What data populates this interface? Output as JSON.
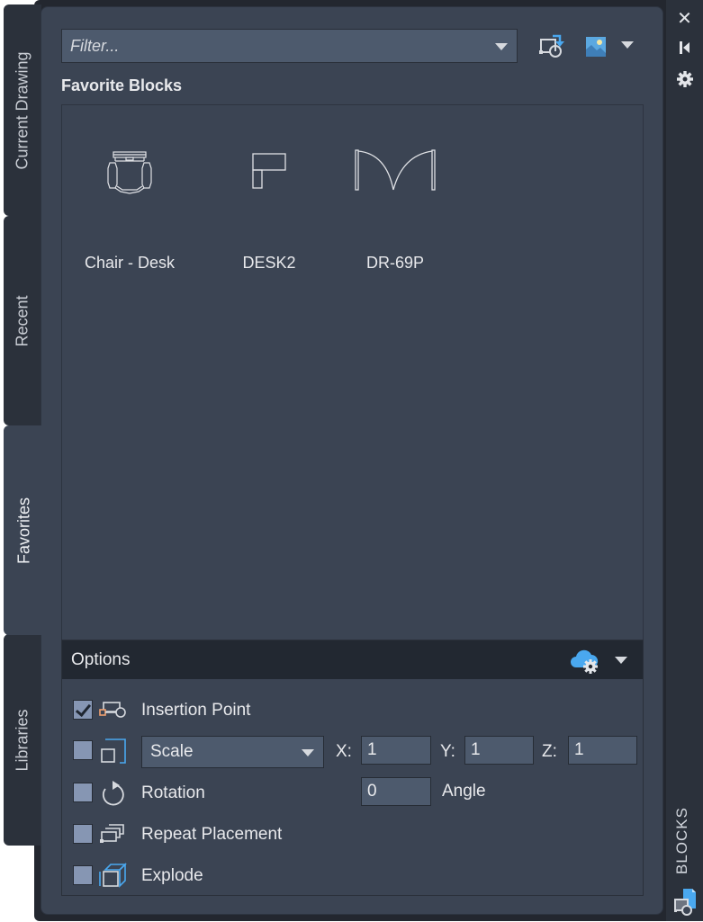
{
  "tabs": [
    {
      "label": "Current Drawing",
      "active": false
    },
    {
      "label": "Recent",
      "active": false
    },
    {
      "label": "Favorites",
      "active": true
    },
    {
      "label": "Libraries",
      "active": false
    }
  ],
  "toolbar": {
    "filter_placeholder": "Filter...",
    "filter_value": "",
    "import_icon": "import-block-icon",
    "view_icon": "thumbnail-view-icon"
  },
  "section_title": "Favorite Blocks",
  "blocks": [
    {
      "name": "Chair - Desk",
      "icon": "chair-desk-preview"
    },
    {
      "name": "DESK2",
      "icon": "desk2-preview"
    },
    {
      "name": "DR-69P",
      "icon": "door-preview"
    }
  ],
  "options": {
    "title": "Options",
    "insertion_point": {
      "label": "Insertion Point",
      "checked": true
    },
    "scale": {
      "checked": false,
      "mode": "Scale",
      "x_label": "X:",
      "x": "1",
      "y_label": "Y:",
      "y": "1",
      "z_label": "Z:",
      "z": "1"
    },
    "rotation": {
      "label": "Rotation",
      "checked": false,
      "angle": "0",
      "angle_label": "Angle"
    },
    "repeat_placement": {
      "label": "Repeat Placement",
      "checked": false
    },
    "explode": {
      "label": "Explode",
      "checked": false
    }
  },
  "palette": {
    "title": "BLOCKS",
    "accent": "#4aa8ef"
  }
}
